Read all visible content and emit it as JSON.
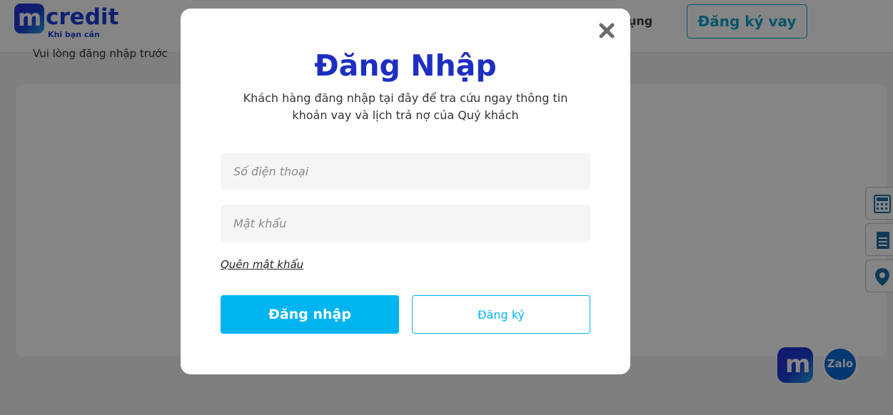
{
  "header": {
    "logo_word": "credit",
    "logo_mark": "m",
    "logo_tagline": "Khi bạn cần",
    "nav_partial": "ụng",
    "register_loan_label": "Đăng ký vay"
  },
  "page": {
    "note": "Vui lòng đăng nhập trước"
  },
  "side_tools": [
    "calculator-icon",
    "document-icon",
    "location-pin-icon"
  ],
  "chat": {
    "mcredit_label": "m",
    "zalo_label": "Zalo"
  },
  "modal": {
    "title": "Đăng Nhập",
    "subtitle": "Khách hàng đăng nhập tại đây để tra cứu ngay thông tin khoản vay và lịch trả nợ của Quý khách",
    "phone_placeholder": "Số điện thoại",
    "password_placeholder": "Mật khẩu",
    "forgot_password": "Quên mật khẩu",
    "login_label": "Đăng nhập",
    "register_label": "Đăng ký"
  },
  "colors": {
    "brand_blue": "#1d2fc2",
    "accent_cyan": "#00b4f0"
  }
}
